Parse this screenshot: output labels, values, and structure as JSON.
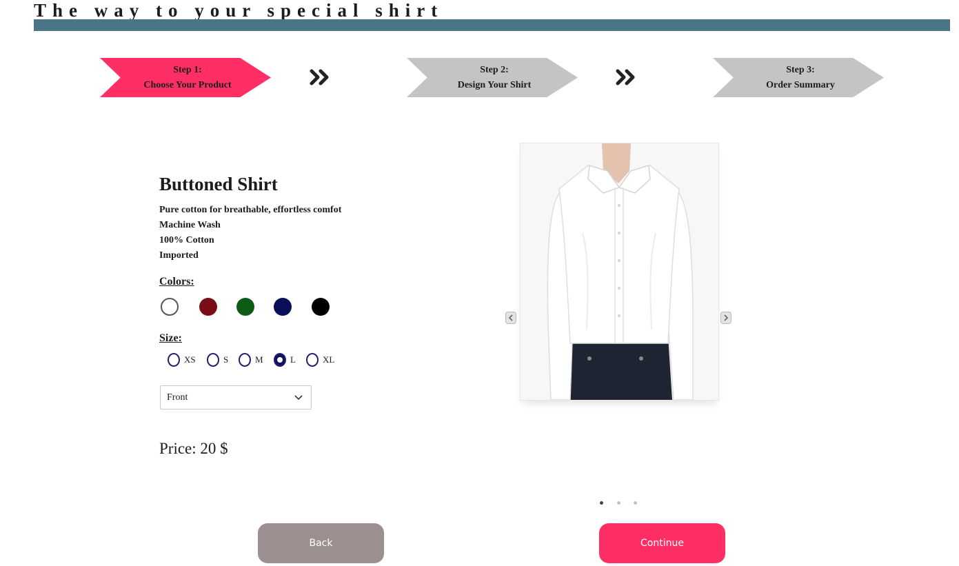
{
  "header": {
    "title": "The way to your special shirt"
  },
  "steps": [
    {
      "number": "Step 1:",
      "label": "Choose Your Product"
    },
    {
      "number": "Step 2:",
      "label": "Design Your Shirt"
    },
    {
      "number": "Step 3:",
      "label": "Order Summary"
    }
  ],
  "product": {
    "name": "Buttoned Shirt",
    "features": [
      "Pure cotton for breathable, effortless comfot",
      "Machine Wash",
      "100% Cotton",
      "Imported"
    ],
    "colors_label": "Colors:",
    "colors": [
      "#ffffff",
      "#7a0e16",
      "#0d5c14",
      "#0a0f5a",
      "#000000"
    ],
    "selected_color": "#ffffff",
    "size_label": "Size:",
    "sizes": [
      "XS",
      "S",
      "M",
      "L",
      "XL"
    ],
    "selected_size": "L",
    "view_select": {
      "value": "Front"
    },
    "price": "Price: 20 $"
  },
  "carousel": {
    "slides": 3,
    "active_slide": 1
  },
  "actions": {
    "back_label": "Back",
    "continue_label": "Continue"
  },
  "theme": {
    "accent": "#ff2f66",
    "bar": "#4a7587",
    "back_button": "#9c8f8f",
    "inactive_step": "#c4c4c4"
  }
}
